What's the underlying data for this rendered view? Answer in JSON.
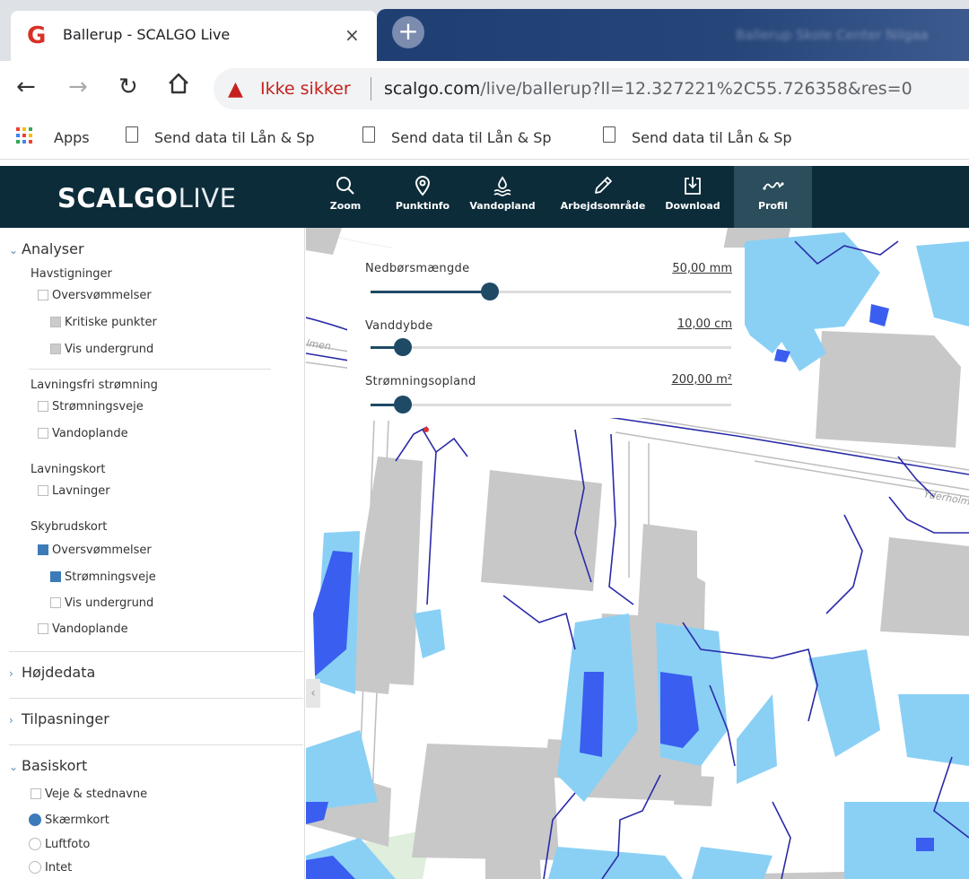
{
  "browser": {
    "tab_title": "Ballerup - SCALGO Live",
    "tab_favicon": "G",
    "tab_close": "×",
    "new_tab": "+",
    "blurred_tab_text": "Ballerup Skole Center Nilgaa",
    "warning_text": "Ikke sikker",
    "url_host": "scalgo.com",
    "url_path": "/live/ballerup?ll=12.327221%2C55.726358&res=0",
    "bookmarks": {
      "apps_label": "Apps",
      "items": [
        "Send data til Lån & Sp",
        "Send data til Lån & Sp",
        "Send data til Lån & Sp"
      ]
    }
  },
  "app": {
    "logo_main": "SCALGO",
    "logo_live": "LIVE",
    "tools": [
      {
        "label": "Zoom",
        "icon": "search-icon"
      },
      {
        "label": "Punktinfo",
        "icon": "map-pin-icon"
      },
      {
        "label": "Vandopland",
        "icon": "water-icon"
      },
      {
        "label": "Arbejdsområde",
        "icon": "pencil-icon"
      },
      {
        "label": "Download",
        "icon": "download-icon"
      },
      {
        "label": "Profil",
        "icon": "profile-line-icon",
        "active": true
      }
    ]
  },
  "sidebar": {
    "analyser": "Analyser",
    "havstigninger": "Havstigninger",
    "hav_oversvommelser": "Oversvømmelser",
    "hav_kritiske": "Kritiske punkter",
    "hav_undergrund": "Vis undergrund",
    "lavningsfri": "Lavningsfri strømning",
    "lf_stromningsveje": "Strømningsveje",
    "lf_vandoplande": "Vandoplande",
    "lavningskort": "Lavningskort",
    "lk_lavninger": "Lavninger",
    "skybrudskort": "Skybrudskort",
    "sk_oversvommelser": "Oversvømmelser",
    "sk_stromningsveje": "Strømningsveje",
    "sk_undergrund": "Vis undergrund",
    "sk_vandoplande": "Vandoplande",
    "hojdedata": "Højdedata",
    "tilpasninger": "Tilpasninger",
    "basiskort": "Basiskort",
    "bk_veje": "Veje & stednavne",
    "bk_skaermkort": "Skærmkort",
    "bk_luftfoto": "Luftfoto",
    "bk_intet": "Intet"
  },
  "sliders": [
    {
      "label": "Nedbørsmængde",
      "value": "50,00 mm",
      "fraction": 0.33
    },
    {
      "label": "Vanddybde",
      "value": "10,00 cm",
      "fraction": 0.09
    },
    {
      "label": "Strømningsopland",
      "value": "200,00 m²",
      "fraction": 0.09
    }
  ],
  "map": {
    "street_labels": [
      "Yderholm",
      "lmen"
    ]
  },
  "colors": {
    "header": "#0c2c3a",
    "accent": "#3d7ab8",
    "flood_light": "#8ad0f5",
    "flood_deep": "#3a5ef0",
    "stream": "#2a2aa8",
    "building": "#c8c8c8"
  }
}
